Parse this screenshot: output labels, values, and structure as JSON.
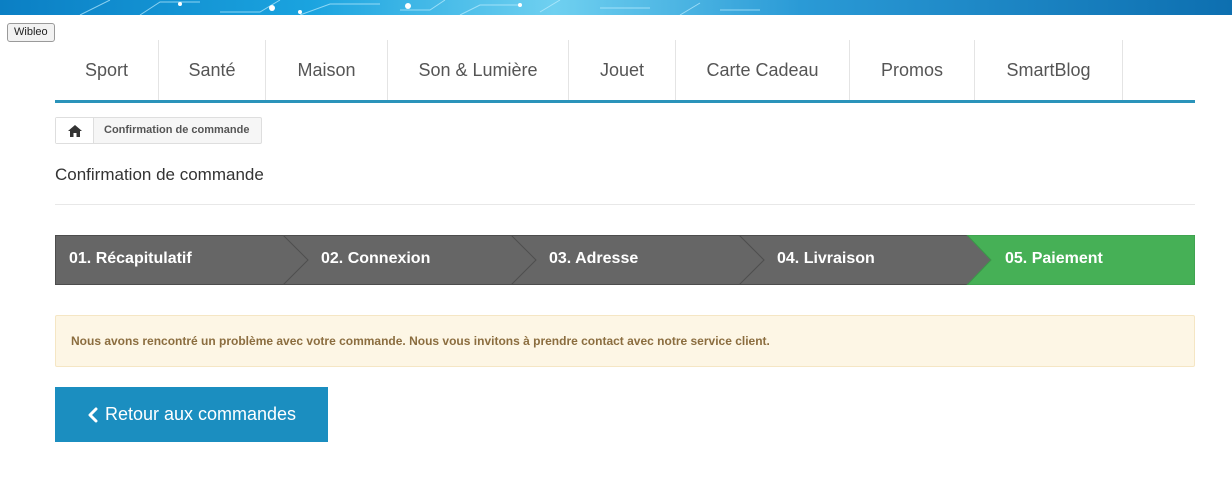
{
  "tooltip": "Wibleo",
  "menu": {
    "items": [
      {
        "label": "Sport"
      },
      {
        "label": "Santé"
      },
      {
        "label": "Maison"
      },
      {
        "label": "Son & Lumière"
      },
      {
        "label": "Jouet"
      },
      {
        "label": "Carte Cadeau"
      },
      {
        "label": "Promos"
      },
      {
        "label": "SmartBlog"
      }
    ]
  },
  "breadcrumb": {
    "home_icon": "home-icon",
    "current": "Confirmation de commande"
  },
  "page": {
    "title": "Confirmation de commande"
  },
  "steps": {
    "items": [
      {
        "label": "01. Récapitulatif",
        "state": "done"
      },
      {
        "label": "02. Connexion",
        "state": "done"
      },
      {
        "label": "03. Adresse",
        "state": "done"
      },
      {
        "label": "04. Livraison",
        "state": "done"
      },
      {
        "label": "05. Paiement",
        "state": "current"
      }
    ],
    "colors": {
      "done": "#666666",
      "current": "#46b056"
    }
  },
  "alert": {
    "message": "Nous avons rencontré un problème avec votre commande. Nous vous invitons à prendre contact avec notre service client."
  },
  "back_button": {
    "icon": "chevron-left-icon",
    "label": "Retour aux commandes"
  }
}
